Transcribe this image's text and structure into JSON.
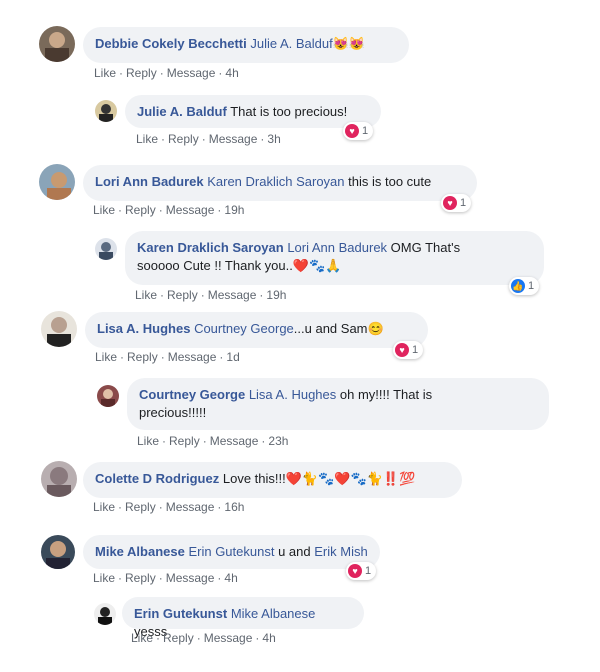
{
  "actions": {
    "like": "Like",
    "reply": "Reply",
    "message": "Message",
    "sep": "·"
  },
  "comments": [
    {
      "author": "Debbie Cokely Becchetti",
      "mention": "Julie A. Balduf",
      "text": "",
      "emojis": "😻😻",
      "time": "4h"
    },
    {
      "author": "Julie A. Balduf",
      "text": "That is too precious!",
      "time": "3h",
      "reaction": {
        "type": "love",
        "count": "1"
      }
    },
    {
      "author": "Lori Ann Badurek",
      "mention": "Karen Draklich Saroyan",
      "text": "this is too cute",
      "time": "19h",
      "reaction": {
        "type": "love",
        "count": "1"
      }
    },
    {
      "author": "Karen Draklich Saroyan",
      "mention": "Lori Ann Badurek",
      "text": "OMG That's",
      "text2": "sooooo Cute !! Thank you..",
      "emojis": "❤️🐾🙏",
      "time": "19h",
      "reaction": {
        "type": "like",
        "count": "1"
      }
    },
    {
      "author": "Lisa A. Hughes",
      "mention": "Courtney George",
      "text": "...u and Sam",
      "emojis": "😊",
      "time": "1d",
      "reaction": {
        "type": "love",
        "count": "1"
      }
    },
    {
      "author": "Courtney George",
      "mention": "Lisa A. Hughes",
      "text": "oh my!!!! That is",
      "text2": "precious!!!!!",
      "time": "23h"
    },
    {
      "author": "Colette D Rodriguez",
      "text": "Love this!!!",
      "emojis": "❤️🐈🐾❤️🐾🐈‼️💯",
      "time": "16h"
    },
    {
      "author": "Mike Albanese",
      "mention": "Erin Gutekunst",
      "text": "u and",
      "mention2": "Erik Mish",
      "time": "4h",
      "reaction": {
        "type": "love",
        "count": "1"
      }
    },
    {
      "author": "Erin Gutekunst",
      "mention": "Mike Albanese",
      "text": "yesss",
      "time": "4h"
    }
  ]
}
